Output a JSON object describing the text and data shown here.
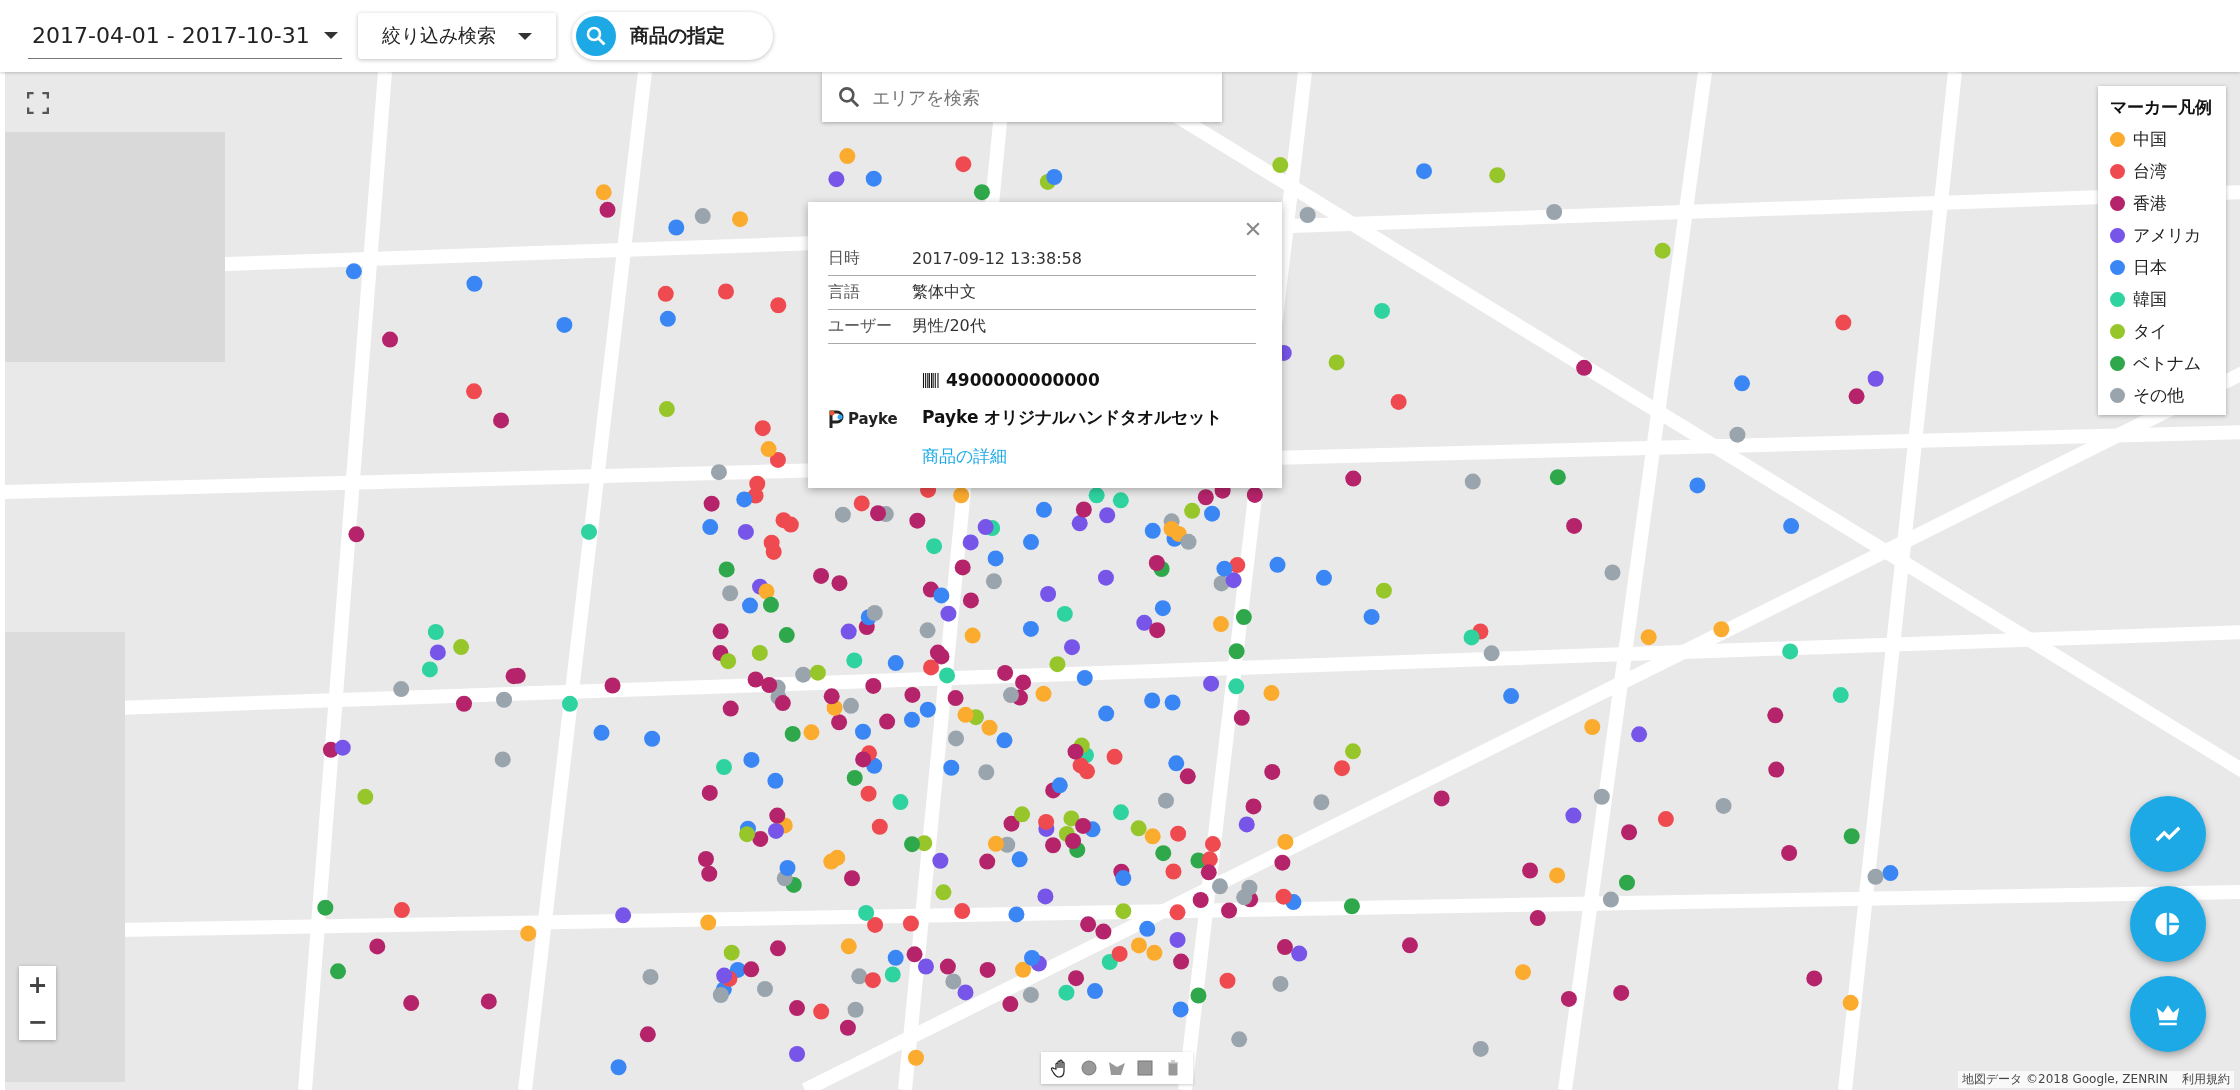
{
  "toolbar": {
    "date_range": "2017-04-01 - 2017-10-31",
    "filter_button": "絞り込み検索",
    "product_button": "商品の指定"
  },
  "map": {
    "search": {
      "placeholder": "エリアを検索"
    },
    "popup": {
      "rows": [
        {
          "label": "日時",
          "value": "2017-09-12 13:38:58"
        },
        {
          "label": "言語",
          "value": "繁体中文"
        },
        {
          "label": "ユーザー",
          "value": "男性/20代"
        }
      ],
      "brand": "Payke",
      "barcode": "4900000000000",
      "product_name": "Payke オリジナルハンドタオルセット",
      "link": "商品の詳細"
    },
    "legend": {
      "title": "マーカー凡例",
      "items": [
        {
          "label": "中国",
          "color": "#fbab2e"
        },
        {
          "label": "台湾",
          "color": "#ef4a4f"
        },
        {
          "label": "香港",
          "color": "#b5246a"
        },
        {
          "label": "アメリカ",
          "color": "#7655e8"
        },
        {
          "label": "日本",
          "color": "#3a86f5"
        },
        {
          "label": "韓国",
          "color": "#2ed3a0"
        },
        {
          "label": "タイ",
          "color": "#96c62a"
        },
        {
          "label": "ベトナム",
          "color": "#2ea84a"
        },
        {
          "label": "その他",
          "color": "#9aa4ad"
        }
      ]
    },
    "zoom_in": "+",
    "zoom_out": "−",
    "attribution": "地図データ ©2018 Google, ZENRIN",
    "terms": "利用規約"
  }
}
